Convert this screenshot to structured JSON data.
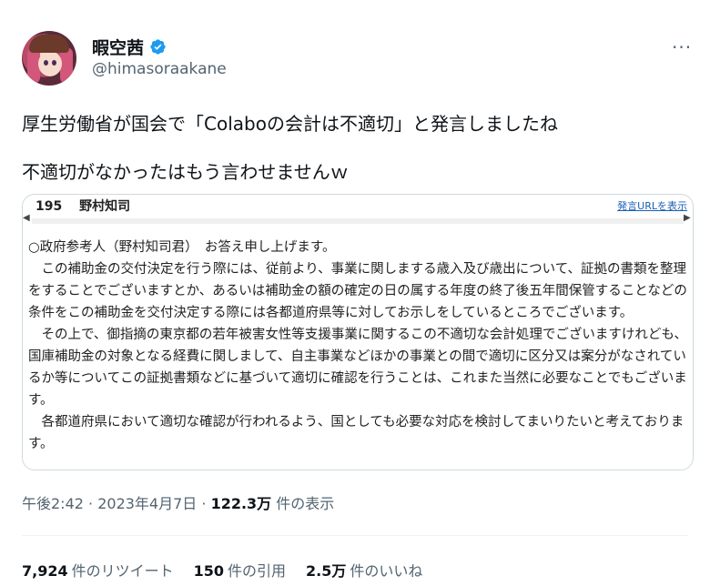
{
  "tweet": {
    "display_name": "暇空茜",
    "handle": "@himasoraakane",
    "more_label": "···",
    "text_line1": "厚生労働省が国会で「Colaboの会計は不適切」と発言しましたね",
    "text_line2": "不適切がなかったはもう言わせませんｗ"
  },
  "embedded": {
    "number": "195",
    "speaker": "野村知司",
    "link": "発言URLを表示",
    "paragraphs": [
      "○政府参考人（野村知司君）　お答え申し上げます。",
      "　この補助金の交付決定を行う際には、従前より、事業に関しまする歳入及び歳出について、証拠の書類を整理をすることでございますとか、あるいは補助金の額の確定の日の属する年度の終了後五年間保管することなどの条件をこの補助金を交付決定する際には各都道府県等に対してお示しをしているところでございます。",
      "　その上で、御指摘の東京都の若年被害女性等支援事業に関するこの不適切な会計処理でございますけれども、国庫補助金の対象となる経費に関しまして、自主事業などほかの事業との間で適切に区分又は案分がなされているか等についてこの証拠書類などに基づいて適切に確認を行うことは、これまた当然に必要なことでもございます。",
      "　各都道府県において適切な確認が行われるよう、国としても必要な対応を検討してまいりたいと考えております。"
    ]
  },
  "meta": {
    "time": "午後2:42",
    "sep1": " · ",
    "date": "2023年4月7日",
    "sep2": " · ",
    "views": "122.3万",
    "views_label": " 件の表示"
  },
  "stats": {
    "retweets": "7,924",
    "retweets_label": "件のリツイート",
    "quotes": "150",
    "quotes_label": "件の引用",
    "likes": "2.5万",
    "likes_label": "件のいいね"
  },
  "colors": {
    "verified": "#1d9bf0",
    "secondary_text": "#536471",
    "link": "#1a5fb4"
  }
}
